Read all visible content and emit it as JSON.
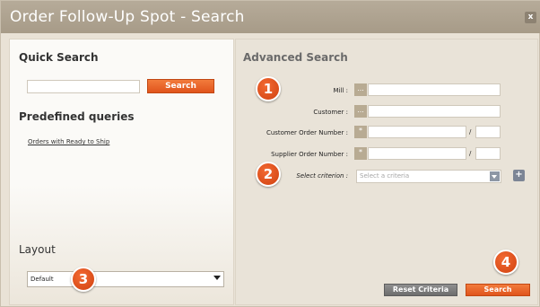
{
  "window": {
    "title": "Order Follow-Up Spot - Search",
    "close_label": "x"
  },
  "quick_search": {
    "heading": "Quick Search",
    "input_value": "",
    "button_label": "Search"
  },
  "predefined": {
    "heading": "Predefined queries",
    "links": [
      "Orders with Ready to Ship"
    ]
  },
  "layout": {
    "heading": "Layout",
    "selected": "Default"
  },
  "advanced": {
    "heading": "Advanced Search",
    "mill_label": "Mill :",
    "customer_label": "Customer :",
    "customer_order_label": "Customer Order Number :",
    "supplier_order_label": "Supplier Order Number :",
    "select_criterion_label": "Select criterion :",
    "criteria_placeholder": "Select a criteria",
    "lookup_glyph": "...",
    "wildcard_glyph": "*",
    "slash": "/",
    "plus": "+"
  },
  "actions": {
    "reset_label": "Reset Criteria",
    "search_label": "Search"
  },
  "badges": [
    "1",
    "2",
    "3",
    "4"
  ],
  "colors": {
    "accent": "#e8612a",
    "titlebar": "#b1a592",
    "panel": "#e9e3d8"
  }
}
